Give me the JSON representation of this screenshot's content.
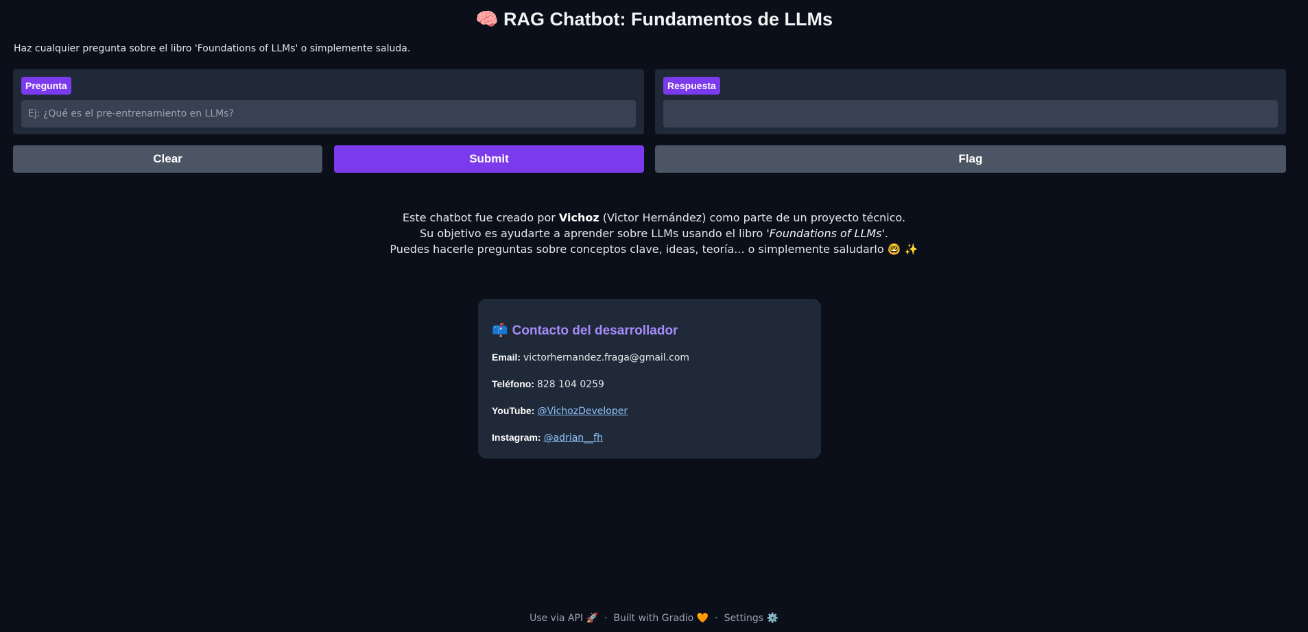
{
  "header": {
    "title": "🧠 RAG Chatbot: Fundamentos de LLMs",
    "description": "Haz cualquier pregunta sobre el libro 'Foundations of LLMs' o simplemente saluda."
  },
  "input": {
    "label": "Pregunta",
    "placeholder": "Ej: ¿Qué es el pre-entrenamiento en LLMs?",
    "value": ""
  },
  "output": {
    "label": "Respuesta",
    "value": ""
  },
  "buttons": {
    "clear": "Clear",
    "submit": "Submit",
    "flag": "Flag"
  },
  "about": {
    "line1_prefix": "Este chatbot fue creado por ",
    "author": "Vichoz",
    "line1_suffix": " (Victor Hernández) como parte de un proyecto técnico.",
    "line2_prefix": "Su objetivo es ayudarte a aprender sobre LLMs usando el libro ",
    "book": "'Foundations of LLMs'",
    "line2_suffix": ".",
    "line3": "Puedes hacerle preguntas sobre conceptos clave, ideas, teoría... o simplemente saludarlo 🤓 ✨"
  },
  "contact": {
    "icon": "📫",
    "title": "Contacto del desarrollador",
    "email_label": "Email:",
    "email": "victorhernandez.fraga@gmail.com",
    "phone_label": "Teléfono:",
    "phone": "828 104 0259",
    "youtube_label": "YouTube:",
    "youtube": "@VichozDeveloper",
    "instagram_label": "Instagram:",
    "instagram": "@adrian__fh"
  },
  "footer": {
    "api": "Use via API 🚀",
    "separator": "·",
    "built": "Built with Gradio 🧡",
    "settings": "Settings ⚙️"
  },
  "colors": {
    "background": "#0b0f19",
    "panel": "#1f2937",
    "accent": "#7c3aed",
    "secondary_button": "#4b5563",
    "link": "#93c5fd",
    "card_title": "#a78bfa"
  }
}
